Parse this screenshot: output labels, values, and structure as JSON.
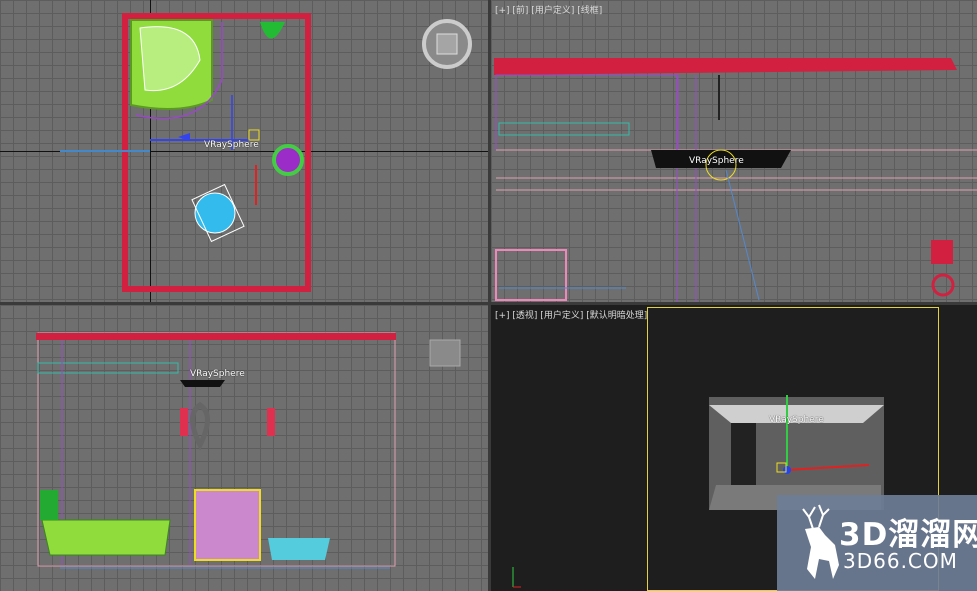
{
  "viewports": {
    "top": {
      "label": "",
      "helper_label": "VRaySphere"
    },
    "front": {
      "label": "[+] [前] [用户定义] [线框]",
      "helper_label": "VRaySphere"
    },
    "left": {
      "label": "",
      "helper_label": "VRaySphere"
    },
    "perspective": {
      "label": "[+] [透视] [用户定义] [默认明暗处理]",
      "helper_label": "VRaySphere"
    }
  },
  "watermark": {
    "brand_cn": "3D溜溜网",
    "brand_url": "3D66.COM"
  },
  "colors": {
    "viewport_bg": "#6f6f6f",
    "grid": "#5d5d5d",
    "active_border": "#e4d23a",
    "frame_red": "#d22040"
  }
}
